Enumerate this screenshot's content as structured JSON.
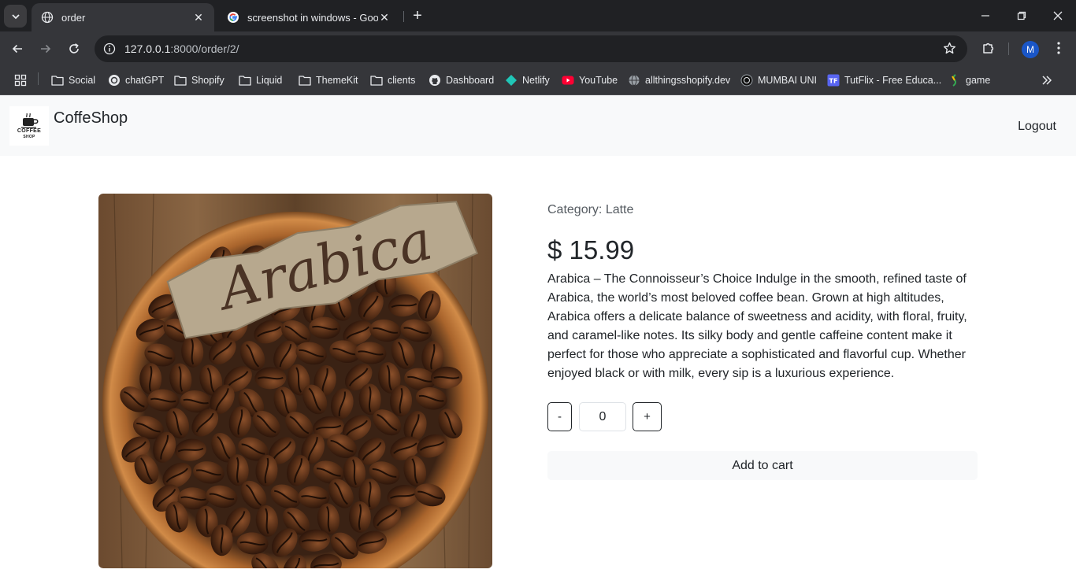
{
  "browser": {
    "tabs": [
      {
        "title": "order",
        "active": true
      },
      {
        "title": "screenshot in windows - Googl",
        "active": false
      }
    ],
    "url_host": "127.0.0.1",
    "url_path": ":8000/order/2/",
    "profile_initial": "M",
    "bookmarks": [
      {
        "label": "Social",
        "icon": "folder-icon"
      },
      {
        "label": "chatGPT",
        "icon": "chatgpt-icon"
      },
      {
        "label": "Shopify",
        "icon": "folder-icon"
      },
      {
        "label": "Liquid",
        "icon": "folder-icon"
      },
      {
        "label": "ThemeKit",
        "icon": "folder-icon"
      },
      {
        "label": "clients",
        "icon": "folder-icon"
      },
      {
        "label": "Dashboard",
        "icon": "github-icon"
      },
      {
        "label": "Netlify",
        "icon": "netlify-icon"
      },
      {
        "label": "YouTube",
        "icon": "youtube-icon"
      },
      {
        "label": "allthingsshopify.dev",
        "icon": "globe-icon"
      },
      {
        "label": "MUMBAI UNI",
        "icon": "university-icon"
      },
      {
        "label": "TutFlix - Free Educa...",
        "icon": "tutflix-icon"
      },
      {
        "label": "game",
        "icon": "game-icon"
      }
    ]
  },
  "site": {
    "brand": "CoffeShop",
    "logo_text": [
      "COFFEE",
      "SHOP"
    ],
    "logout": "Logout"
  },
  "product": {
    "image_text": "Arabica",
    "category": "Category: Latte",
    "price": "$ 15.99",
    "description": "Arabica – The Connoisseur’s Choice Indulge in the smooth, refined taste of Arabica, the world’s most beloved coffee bean. Grown at high altitudes, Arabica offers a delicate balance of sweetness and acidity, with floral, fruity, and caramel-like notes. Its silky body and gentle caffeine content make it perfect for those who appreciate a sophisticated and flavorful cup. Whether enjoyed black or with milk, every sip is a luxurious experience.",
    "minus_label": "-",
    "quantity": "0",
    "plus_label": "+",
    "add_to_cart": "Add to cart"
  },
  "colors": {
    "chrome_dark": "#202124",
    "chrome_bar": "#35363a",
    "navbar_bg": "#f8f9fa",
    "text": "#212529"
  }
}
